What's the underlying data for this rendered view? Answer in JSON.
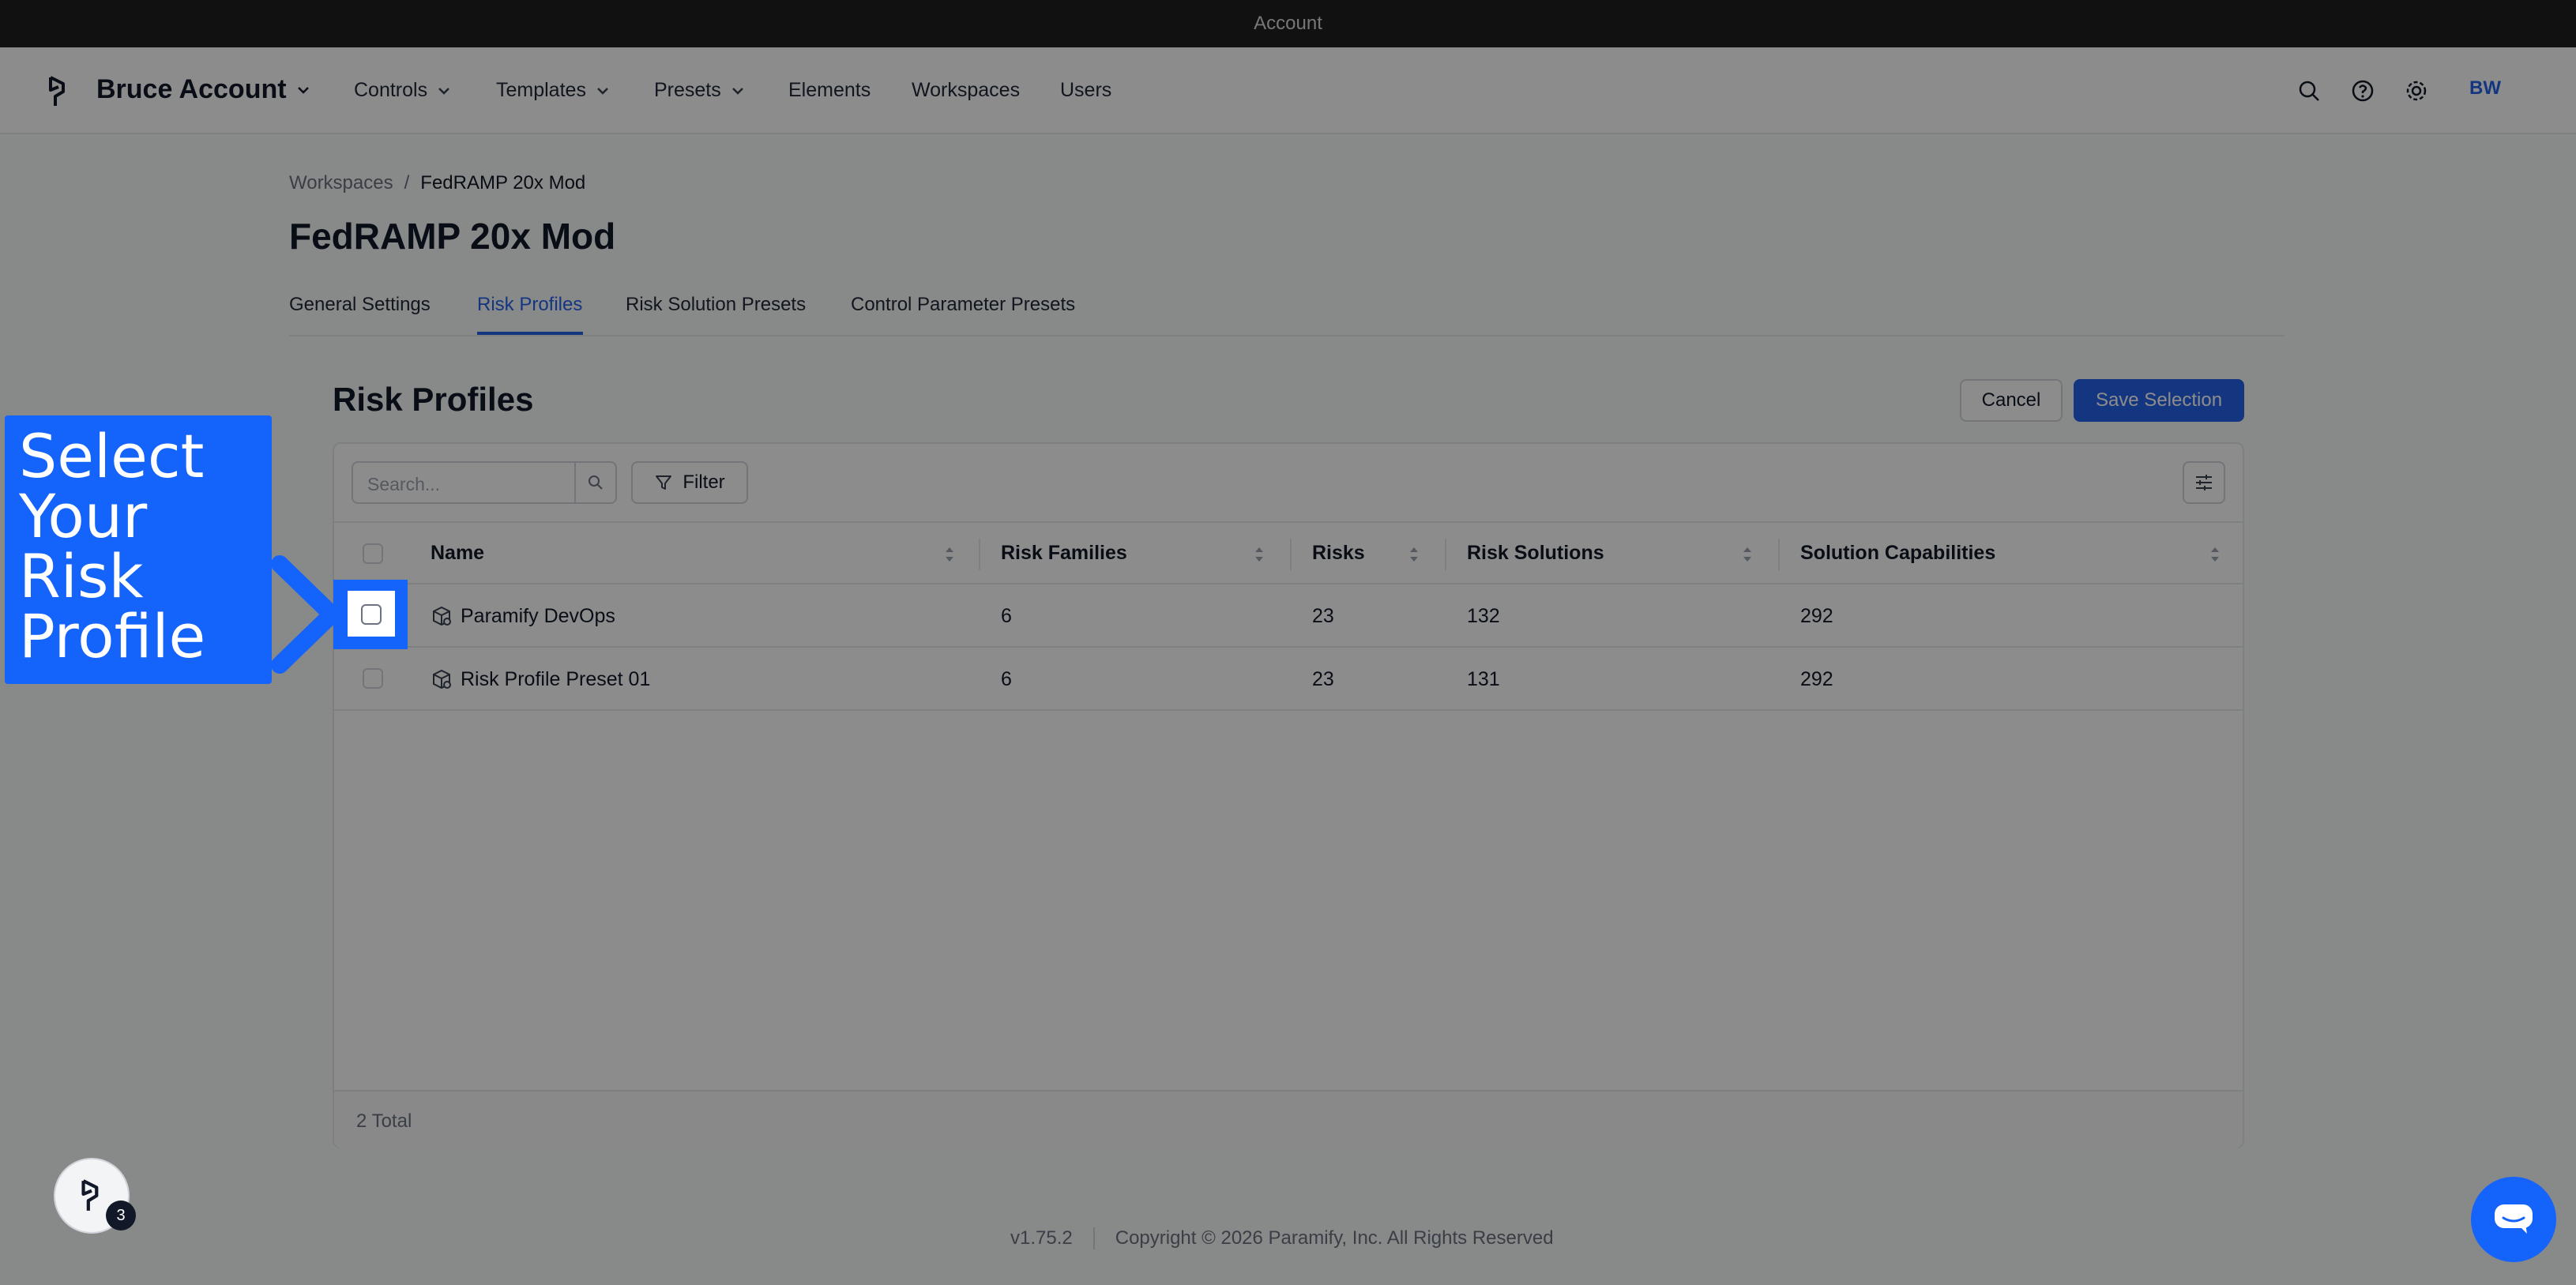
{
  "window": {
    "title": "Account"
  },
  "nav": {
    "brand": "Bruce Account",
    "items": [
      {
        "label": "Controls"
      },
      {
        "label": "Templates"
      },
      {
        "label": "Presets"
      },
      {
        "label": "Elements"
      },
      {
        "label": "Workspaces"
      },
      {
        "label": "Users"
      }
    ],
    "avatar_initials": "BW"
  },
  "breadcrumb": {
    "root": "Workspaces",
    "separator": "/",
    "current": "FedRAMP 20x Mod"
  },
  "page": {
    "title": "FedRAMP 20x Mod"
  },
  "tabs": [
    {
      "label": "General Settings"
    },
    {
      "label": "Risk Profiles"
    },
    {
      "label": "Risk Solution Presets"
    },
    {
      "label": "Control Parameter Presets"
    }
  ],
  "section": {
    "title": "Risk Profiles",
    "cancel_label": "Cancel",
    "save_label": "Save Selection"
  },
  "toolbar": {
    "search_placeholder": "Search...",
    "filter_label": "Filter"
  },
  "table": {
    "columns": [
      "Name",
      "Risk Families",
      "Risks",
      "Risk Solutions",
      "Solution Capabilities"
    ],
    "rows": [
      {
        "name": "Paramify DevOps",
        "risk_families": "6",
        "risks": "23",
        "risk_solutions": "132",
        "solution_capabilities": "292"
      },
      {
        "name": "Risk Profile Preset 01",
        "risk_families": "6",
        "risks": "23",
        "risk_solutions": "131",
        "solution_capabilities": "292"
      }
    ],
    "total": "2 Total"
  },
  "footer": {
    "version": "v1.75.2",
    "copyright": "Copyright © 2026 Paramify, Inc. All Rights Reserved"
  },
  "callout": {
    "line1": "Select",
    "line2": "Your Risk",
    "line3": "Profile"
  },
  "help": {
    "badge_count": "3"
  },
  "colors": {
    "accent": "#2563eb",
    "callout": "#1463fb",
    "titlebar": "#202020"
  }
}
